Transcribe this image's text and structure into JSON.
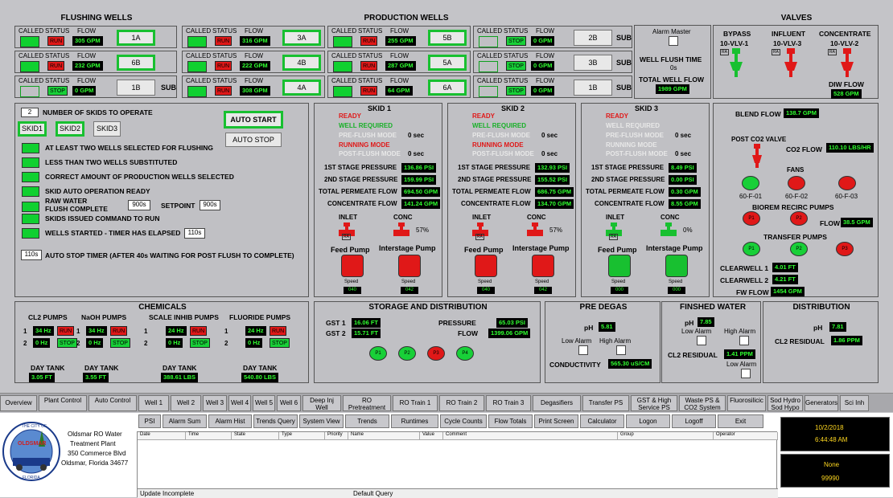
{
  "flushing": {
    "title": "FLUSHING WELLS",
    "rows": [
      {
        "status": "RUN",
        "flow": "305 GPM",
        "btn": "1A"
      },
      {
        "status": "RUN",
        "flow": "232 GPM",
        "btn": "6B"
      },
      {
        "status": "STOP",
        "flow": "0 GPM",
        "btn": "1B"
      }
    ],
    "called": "CALLED",
    "status": "STATUS",
    "flowh": "FLOW",
    "sub": "SUB"
  },
  "production": {
    "title": "PRODUCTION WELLS",
    "rows": [
      [
        {
          "status": "RUN",
          "flow": "316 GPM",
          "btn": "3A"
        },
        {
          "status": "RUN",
          "flow": "255 GPM",
          "btn": "5B"
        },
        {
          "status": "STOP",
          "flow": "0 GPM",
          "btn": "2B"
        }
      ],
      [
        {
          "status": "RUN",
          "flow": "222 GPM",
          "btn": "4B"
        },
        {
          "status": "RUN",
          "flow": "287 GPM",
          "btn": "5A"
        },
        {
          "status": "STOP",
          "flow": "0 GPM",
          "btn": "3B"
        }
      ],
      [
        {
          "status": "RUN",
          "flow": "308 GPM",
          "btn": "4A"
        },
        {
          "status": "RUN",
          "flow": "64 GPM",
          "btn": "6A"
        },
        {
          "status": "STOP",
          "flow": "0 GPM",
          "btn": "1B"
        }
      ]
    ]
  },
  "alarm": {
    "master": "Alarm Master",
    "wft": "WELL FLUSH TIME",
    "wft_val": "0s",
    "twf": "TOTAL WELL FLOW",
    "twf_val": "1989 GPM"
  },
  "valves": {
    "title": "VALVES",
    "items": [
      {
        "name": "BYPASS",
        "tag": "10-VLV-1"
      },
      {
        "name": "INFLUENT",
        "tag": "10-VLV-3"
      },
      {
        "name": "CONCENTRATE",
        "tag": "10-VLV-2"
      }
    ],
    "ra": "RA",
    "diw": "DIW FLOW",
    "diw_val": "528 GPM"
  },
  "skidctl": {
    "num": "2",
    "num_label": "NUMBER OF SKIDS TO OPERATE",
    "skids": [
      "SKID1",
      "SKID2",
      "SKID3"
    ],
    "auto_start": "AUTO START",
    "auto_stop": "AUTO STOP",
    "conds": [
      "AT LEAST TWO WELLS SELECTED FOR FLUSHING",
      "LESS THAN TWO WELLS SUBSTITUTED",
      "CORRECT AMOUNT OF PRODUCTION WELLS SELECTED",
      "SKID AUTO OPERATION READY",
      "RAW WATER",
      "FLUSH COMPLETE",
      "SKIDS ISSUED COMMAND TO RUN",
      "WELLS STARTED - TIMER HAS ELAPSED"
    ],
    "t900": "900s",
    "setpoint": "SETPOINT",
    "sp_val": "900s",
    "t110": "110s",
    "autostop_val": "110s",
    "autostop": "AUTO STOP TIMER (AFTER 40s WAITING FOR POST FLUSH TO COMPLETE)"
  },
  "skids": [
    {
      "title": "SKID 1",
      "ready": "READY",
      "wr": "WELL REQUIRED",
      "pre": "PRE-FLUSH MODE",
      "pre_t": "0 sec",
      "running": "RUNNING MODE",
      "post": "POST-FLUSH MODE",
      "post_t": "0 sec",
      "p1": "136.86 PSI",
      "p2": "159.99 PSI",
      "tpf": "694.50 GPM",
      "cf": "141.24 GPM",
      "conc": "57%",
      "spd1": "040",
      "spd2": "042",
      "color": "r"
    },
    {
      "title": "SKID 2",
      "ready": "READY",
      "wr": "WELL REQUIRED",
      "pre": "PRE-FLUSH MODE",
      "pre_t": "0 sec",
      "running": "RUNNING MODE",
      "post": "POST-FLUSH MODE",
      "post_t": "0 sec",
      "p1": "132.93 PSI",
      "p2": "155.52 PSI",
      "tpf": "686.75 GPM",
      "cf": "134.70 GPM",
      "conc": "57%",
      "spd1": "040",
      "spd2": "042",
      "color": "r"
    },
    {
      "title": "SKID 3",
      "ready": "READY",
      "wr": "WELL REQUIRED",
      "pre": "PRE-FLUSH MODE",
      "pre_t": "0 sec",
      "running": "RUNNING MODE",
      "post": "POST-FLUSH MODE",
      "post_t": "0 sec",
      "p1": "8.49 PSI",
      "p2": "0.00 PSI",
      "tpf": "0.30 GPM",
      "cf": "8.55 GPM",
      "conc": "0%",
      "spd1": "000",
      "spd2": "000",
      "color": "g"
    }
  ],
  "skidlabels": {
    "p1": "1ST STAGE PRESSURE",
    "p2": "2ND STAGE PRESSURE",
    "tpf": "TOTAL PERMEATE FLOW",
    "cf": "CONCENTRATE FLOW",
    "inlet": "INLET",
    "conc": "CONC",
    "feed": "Feed Pump",
    "inter": "Interstage Pump",
    "speed": "Speed",
    "ra": "RA"
  },
  "blend": {
    "blend": "BLEND FLOW",
    "blend_val": "138.7 GPM",
    "pco2": "POST CO2 VALVE",
    "co2": "CO2 FLOW",
    "co2_val": "110.10 LBS/HR",
    "fans": "FANS",
    "fan_tags": [
      "60-F-01",
      "60-F-02",
      "60-F-03"
    ],
    "biorem": "BIOREM RECIRC PUMPS",
    "p1": "P1",
    "p2": "P2",
    "p3": "P3",
    "flow": "FLOW",
    "flow_val": "38.5 GPM",
    "transfer": "TRANSFER PUMPS",
    "cw1": "CLEARWELL 1",
    "cw1_val": "4.01 FT",
    "cw2": "CLEARWELL 2",
    "cw2_val": "4.21 FT",
    "fw": "FW FLOW",
    "fw_val": "1454 GPM"
  },
  "chem": {
    "title": "CHEMICALS",
    "groups": [
      {
        "name": "CL2 PUMPS",
        "r1": "34 Hz",
        "s1": "RUN",
        "r2": "0 Hz",
        "s2": "STOP",
        "dt": "DAY TANK",
        "dtv": "3.05 FT"
      },
      {
        "name": "NaOH PUMPS",
        "r1": "34 Hz",
        "s1": "RUN",
        "r2": "0 Hz",
        "s2": "STOP",
        "dt": "DAY TANK",
        "dtv": "3.55 FT"
      },
      {
        "name": "SCALE INHIB PUMPS",
        "r1": "24 Hz",
        "s1": "RUN",
        "r2": "0 Hz",
        "s2": "STOP",
        "dt": "DAY TANK",
        "dtv": "388.61 LBS"
      },
      {
        "name": "FLUORIDE PUMPS",
        "r1": "24 Hz",
        "s1": "RUN",
        "r2": "0 Hz",
        "s2": "STOP",
        "dt": "DAY TANK",
        "dtv": "540.80 LBS"
      }
    ],
    "one": "1",
    "two": "2"
  },
  "storage": {
    "title": "STORAGE AND DISTRIBUTION",
    "gst1": "GST 1",
    "gst1_val": "16.06 FT",
    "gst2": "GST 2",
    "gst2_val": "15.71 FT",
    "pressure": "PRESSURE",
    "pressure_val": "65.03 PSI",
    "flow": "FLOW",
    "flow_val": "1399.06 GPM",
    "pumps": [
      "P1",
      "P2",
      "P3",
      "P4"
    ]
  },
  "predegas": {
    "title": "PRE DEGAS",
    "ph": "pH",
    "ph_val": "5.81",
    "low": "Low Alarm",
    "high": "High Alarm",
    "cond": "CONDUCTIVITY",
    "cond_val": "565.30 uS/CM"
  },
  "finished": {
    "title": "FINSHED WATER",
    "ph": "pH",
    "ph_val": "7.85",
    "low": "Low Alarm",
    "high": "High Alarm",
    "cl2": "CL2 RESIDUAL",
    "cl2_val": "1.41 PPM",
    "low2": "Low Alarm"
  },
  "distribution": {
    "title": "DISTRIBUTION",
    "ph": "pH",
    "ph_val": "7.81",
    "cl2": "CL2 RESIDUAL",
    "cl2_val": "1.86 PPM"
  },
  "tabs": [
    "Overview",
    "Plant Control",
    "Auto Control",
    "Well 1",
    "Well 2",
    "Well 3",
    "Well 4",
    "Well 5",
    "Well 6",
    "Deep Inj Well",
    "RO Pretreatment",
    "RO Train 1",
    "RO Train 2",
    "RO Train 3",
    "Degasifiers",
    "Transfer PS",
    "GST & High Service PS",
    "Waste PS & CO2 System",
    "Fluorosilicic",
    "Sod Hydro Sod Hypo",
    "Generators",
    "Sci Inh"
  ],
  "tools": [
    "PSI",
    "Alarm Sum",
    "Alarm Hist",
    "Trends Query",
    "System View",
    "Trends",
    "Runtimes",
    "Cycle Counts",
    "Flow Totals",
    "Print Screen",
    "Calculator",
    "Logon",
    "Logoff",
    "Exit"
  ],
  "plant": {
    "name": "Oldsmar RO Water",
    "name2": "Treatment Plant",
    "addr": "350 Commerce Blvd",
    "city": "Oldsmar, Florida 34677"
  },
  "logo": {
    "top": "THE CITY OF",
    "name": "OLDSMAR",
    "bottom": "FLORIDA"
  },
  "alarmtable": {
    "cols": [
      "Date",
      "Time",
      "State",
      "Type",
      "Priority",
      "Name",
      "Value",
      "Comment",
      "Group",
      "Operator"
    ],
    "status": "Update Incomplete",
    "query": "Default Query"
  },
  "clock": {
    "date": "10/2/2018",
    "time": "6:44:48 AM",
    "user": "None",
    "num": "99990"
  }
}
